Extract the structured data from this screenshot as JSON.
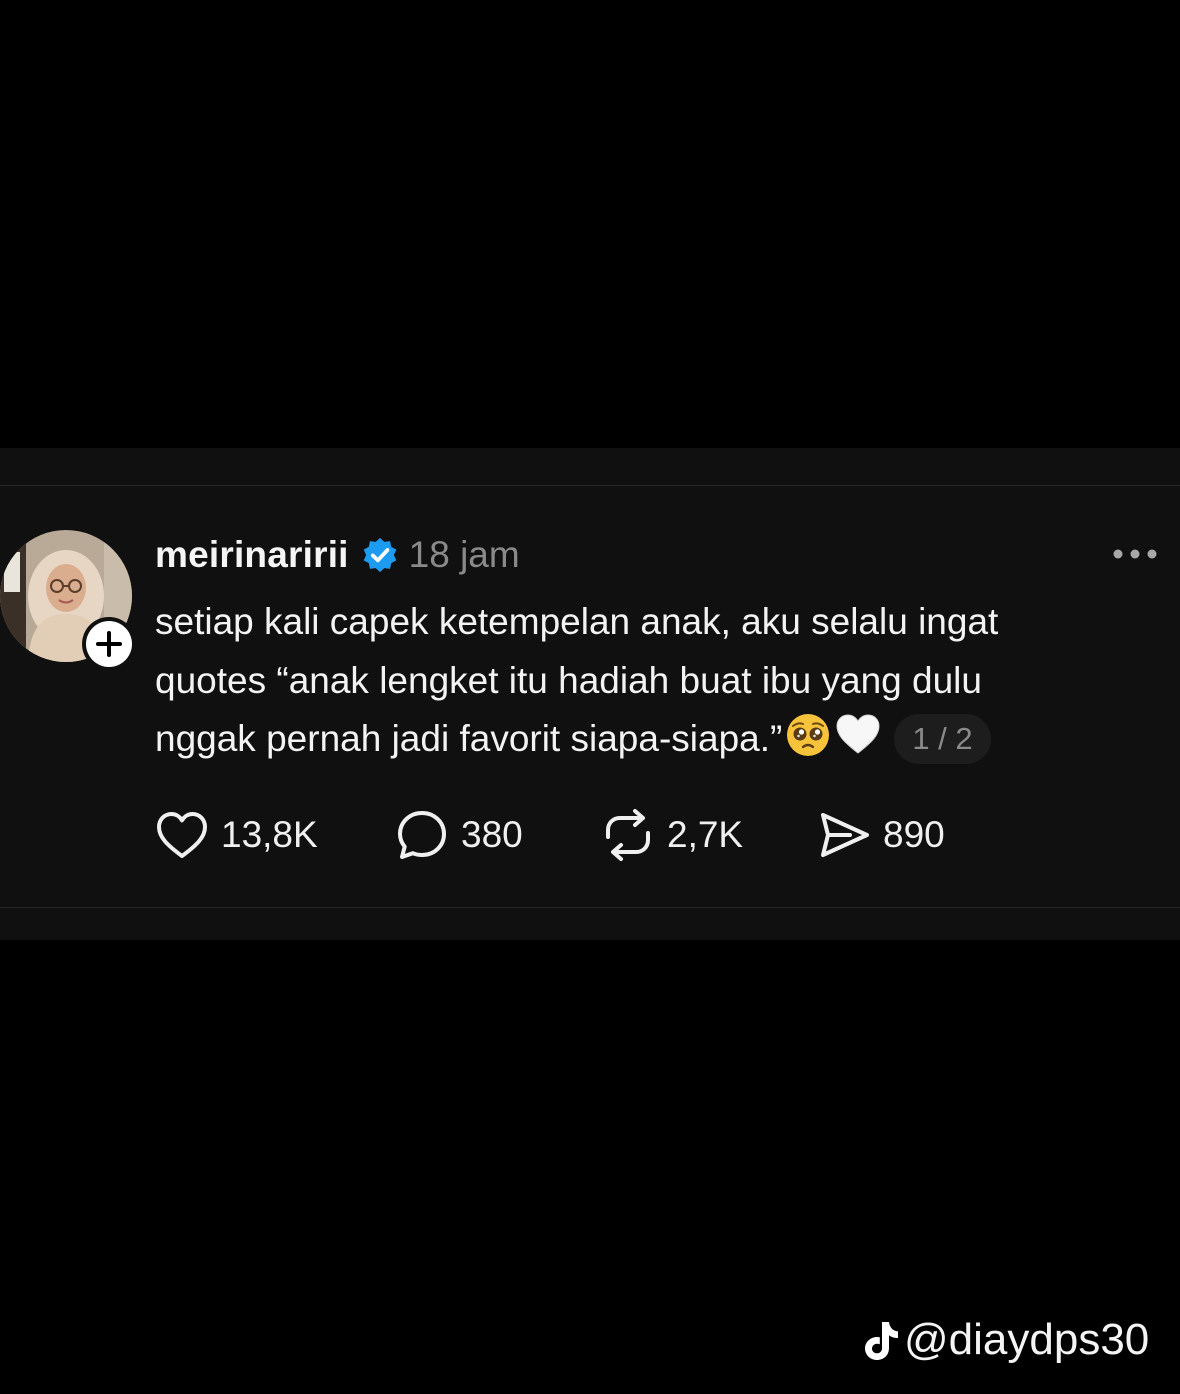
{
  "post": {
    "username": "meirinaririi",
    "verified": true,
    "timestamp": "18 jam",
    "text": "setiap kali capek ketempelan anak, aku selalu ingat\nquotes “anak lengket itu hadiah buat ibu yang dulu\nnggak pernah jadi favorit siapa-siapa.”",
    "page_indicator": "1 / 2",
    "emojis": [
      "pleading-face",
      "white-heart"
    ]
  },
  "actions": {
    "likes": "13,8K",
    "replies": "380",
    "reposts": "2,7K",
    "shares": "890"
  },
  "watermark": {
    "handle": "@diaydps30",
    "icon": "tiktok-logo"
  },
  "colors": {
    "background": "#000000",
    "card": "#101010",
    "verified_badge": "#1d9bf0",
    "muted_text": "#8a8a8a"
  }
}
